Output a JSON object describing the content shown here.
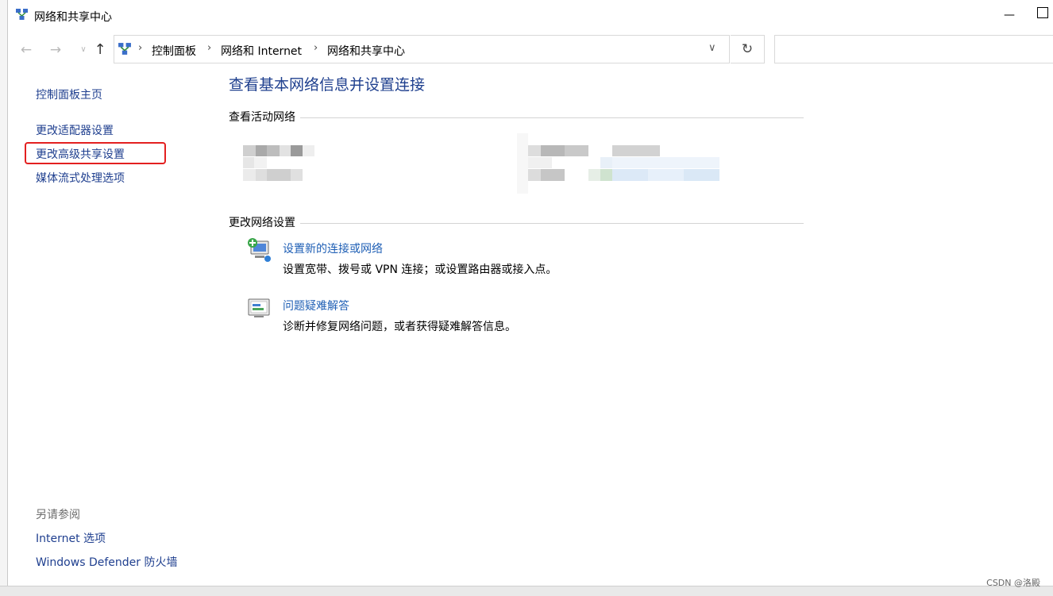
{
  "window": {
    "title": "网络和共享中心"
  },
  "nav": {
    "back_icon": "arrow-left-icon",
    "forward_icon": "arrow-right-icon",
    "recent_icon": "chevron-down-icon",
    "up_icon": "arrow-up-icon"
  },
  "address": {
    "breadcrumbs": [
      "控制面板",
      "网络和 Internet",
      "网络和共享中心"
    ],
    "search_placeholder": ""
  },
  "sidebar": {
    "home": "控制面板主页",
    "links": [
      "更改适配器设置",
      "更改高级共享设置",
      "媒体流式处理选项"
    ],
    "see_also_label": "另请参阅",
    "see_also": [
      "Internet 选项",
      "Windows Defender 防火墙"
    ]
  },
  "main": {
    "title": "查看基本网络信息并设置连接",
    "active_networks_label": "查看活动网络",
    "change_settings_label": "更改网络设置",
    "tasks": [
      {
        "link": "设置新的连接或网络",
        "desc": "设置宽带、拨号或 VPN 连接；或设置路由器或接入点。"
      },
      {
        "link": "问题疑难解答",
        "desc": "诊断并修复网络问题，或者获得疑难解答信息。"
      }
    ]
  },
  "footer": {
    "watermark": "CSDN @洛殿"
  },
  "colors": {
    "link": "#1f3f8f",
    "title_blue": "#1e3f8e",
    "task_link": "#1f5fb5",
    "highlight": "#e32020"
  }
}
